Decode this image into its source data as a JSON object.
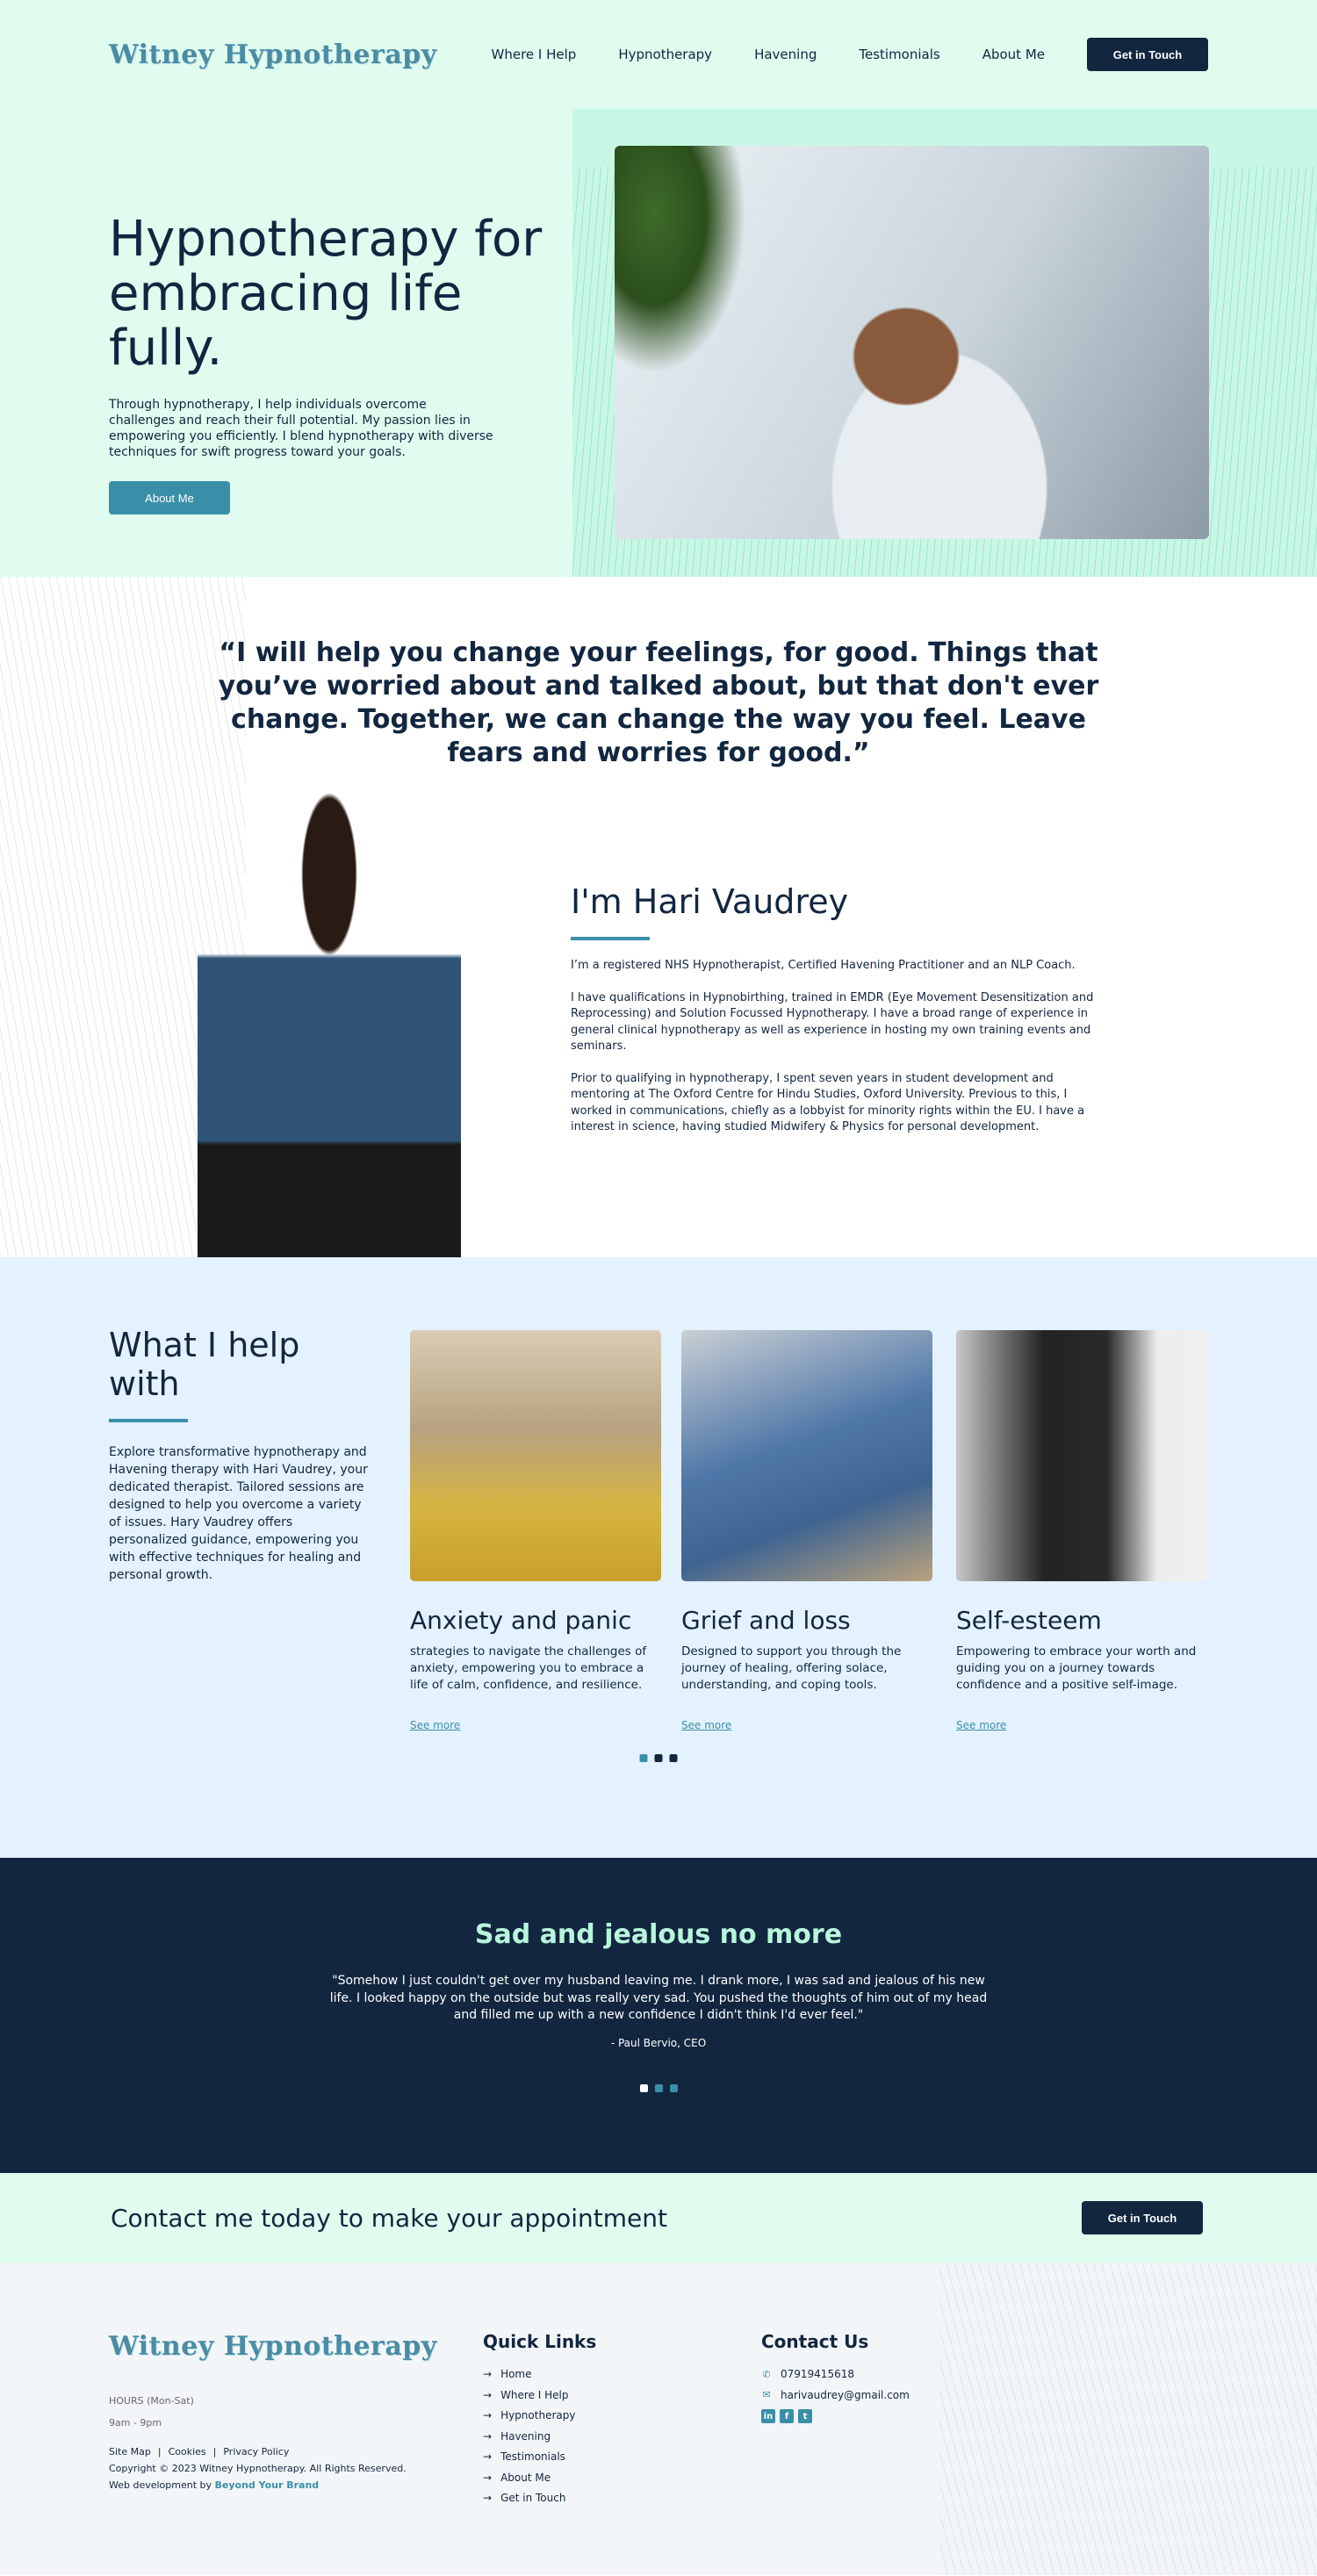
{
  "nav": {
    "logo": "Witney Hypnotherapy",
    "links": [
      "Where I Help",
      "Hypnotherapy",
      "Havening",
      "Testimonials",
      "About Me"
    ],
    "cta": "Get in Touch"
  },
  "hero": {
    "title": "Hypnotherapy for embracing life fully.",
    "text": "Through hypnotherapy, I help individuals overcome challenges and reach their full potential. My passion lies in empowering you efficiently. I blend hypnotherapy with diverse techniques for swift progress toward your goals.",
    "button": "About Me"
  },
  "quote": "“I will help you change your feelings, for good. Things that you’ve worried about and talked about, but that don't ever change. Together, we can change the way you feel.  Leave fears and worries for good.”",
  "about": {
    "heading": "I'm Hari Vaudrey",
    "p1": "I’m a registered NHS Hypnotherapist, Certified Havening Practitioner and an NLP Coach.",
    "p2": "I have qualifications in Hypnobirthing, trained in EMDR (Eye Movement Desensitization and Reprocessing) and Solution Focussed Hypnotherapy.  I have a broad range of experience in general clinical hypnotherapy as well as experience in hosting my own training events and seminars.",
    "p3": "Prior to qualifying in hypnotherapy, I spent seven years in student development and mentoring at The Oxford Centre for Hindu Studies, Oxford University. Previous to this, I worked in communications, chiefly as a lobbyist for minority rights within the EU. I have a interest in science, having studied Midwifery & Physics for personal development."
  },
  "help": {
    "title": "What I help with",
    "text": "Explore transformative hypnotherapy and Havening therapy with Hari Vaudrey, your dedicated therapist. Tailored sessions are designed to help you overcome a variety of issues. Hary Vaudrey offers personalized guidance, empowering you with effective techniques for healing and personal growth.",
    "cards": [
      {
        "title": "Anxiety and panic",
        "text": "strategies to navigate the challenges of anxiety, empowering you to embrace a life of calm, confidence, and resilience.",
        "link": "See more"
      },
      {
        "title": "Grief and loss",
        "text": "Designed to support you through the journey of healing, offering solace, understanding, and coping tools.",
        "link": "See more"
      },
      {
        "title": "Self-esteem",
        "text": "Empowering to embrace your worth and guiding you on a journey towards confidence and a positive self-image.",
        "link": "See more"
      }
    ]
  },
  "testimonial": {
    "title": "Sad and jealous no more",
    "text": "\"Somehow I just couldn't get over my husband leaving me. I drank more, I was sad and jealous of his new life. I looked happy on the outside but was really very sad. You pushed the thoughts of him out of my head and filled me up with a new confidence I didn't think I'd ever feel.\"",
    "author": "- Paul Bervio, CEO"
  },
  "cta": {
    "text": "Contact me today to make your appointment",
    "button": "Get in Touch"
  },
  "footer": {
    "logo": "Witney Hypnotherapy",
    "hours_label": "HOURS (Mon-Sat)",
    "hours_value": "9am - 9pm",
    "legal": [
      "Site Map",
      "Cookies",
      "Privacy Policy"
    ],
    "separator": "|",
    "copyright": "Copyright © 2023 Witney Hypnotherapy. All Rights Reserved.",
    "webdev_prefix": "Web development by",
    "webdev_link": "Beyond Your Brand",
    "quick_links_heading": "Quick Links",
    "quick_links": [
      "Home",
      "Where I Help",
      "Hypnotherapy",
      "Havening",
      "Testimonials",
      "About Me",
      "Get in Touch"
    ],
    "contact_heading": "Contact Us",
    "phone": "07919415618",
    "email": "harivaudrey@gmail.com",
    "social_icons": [
      "linkedin-icon",
      "facebook-icon",
      "twitter-icon"
    ]
  },
  "colors": {
    "navy": "#12263f",
    "teal": "#3a8fa8",
    "mint": "#dffcef",
    "light_blue": "#e4f1ff"
  }
}
